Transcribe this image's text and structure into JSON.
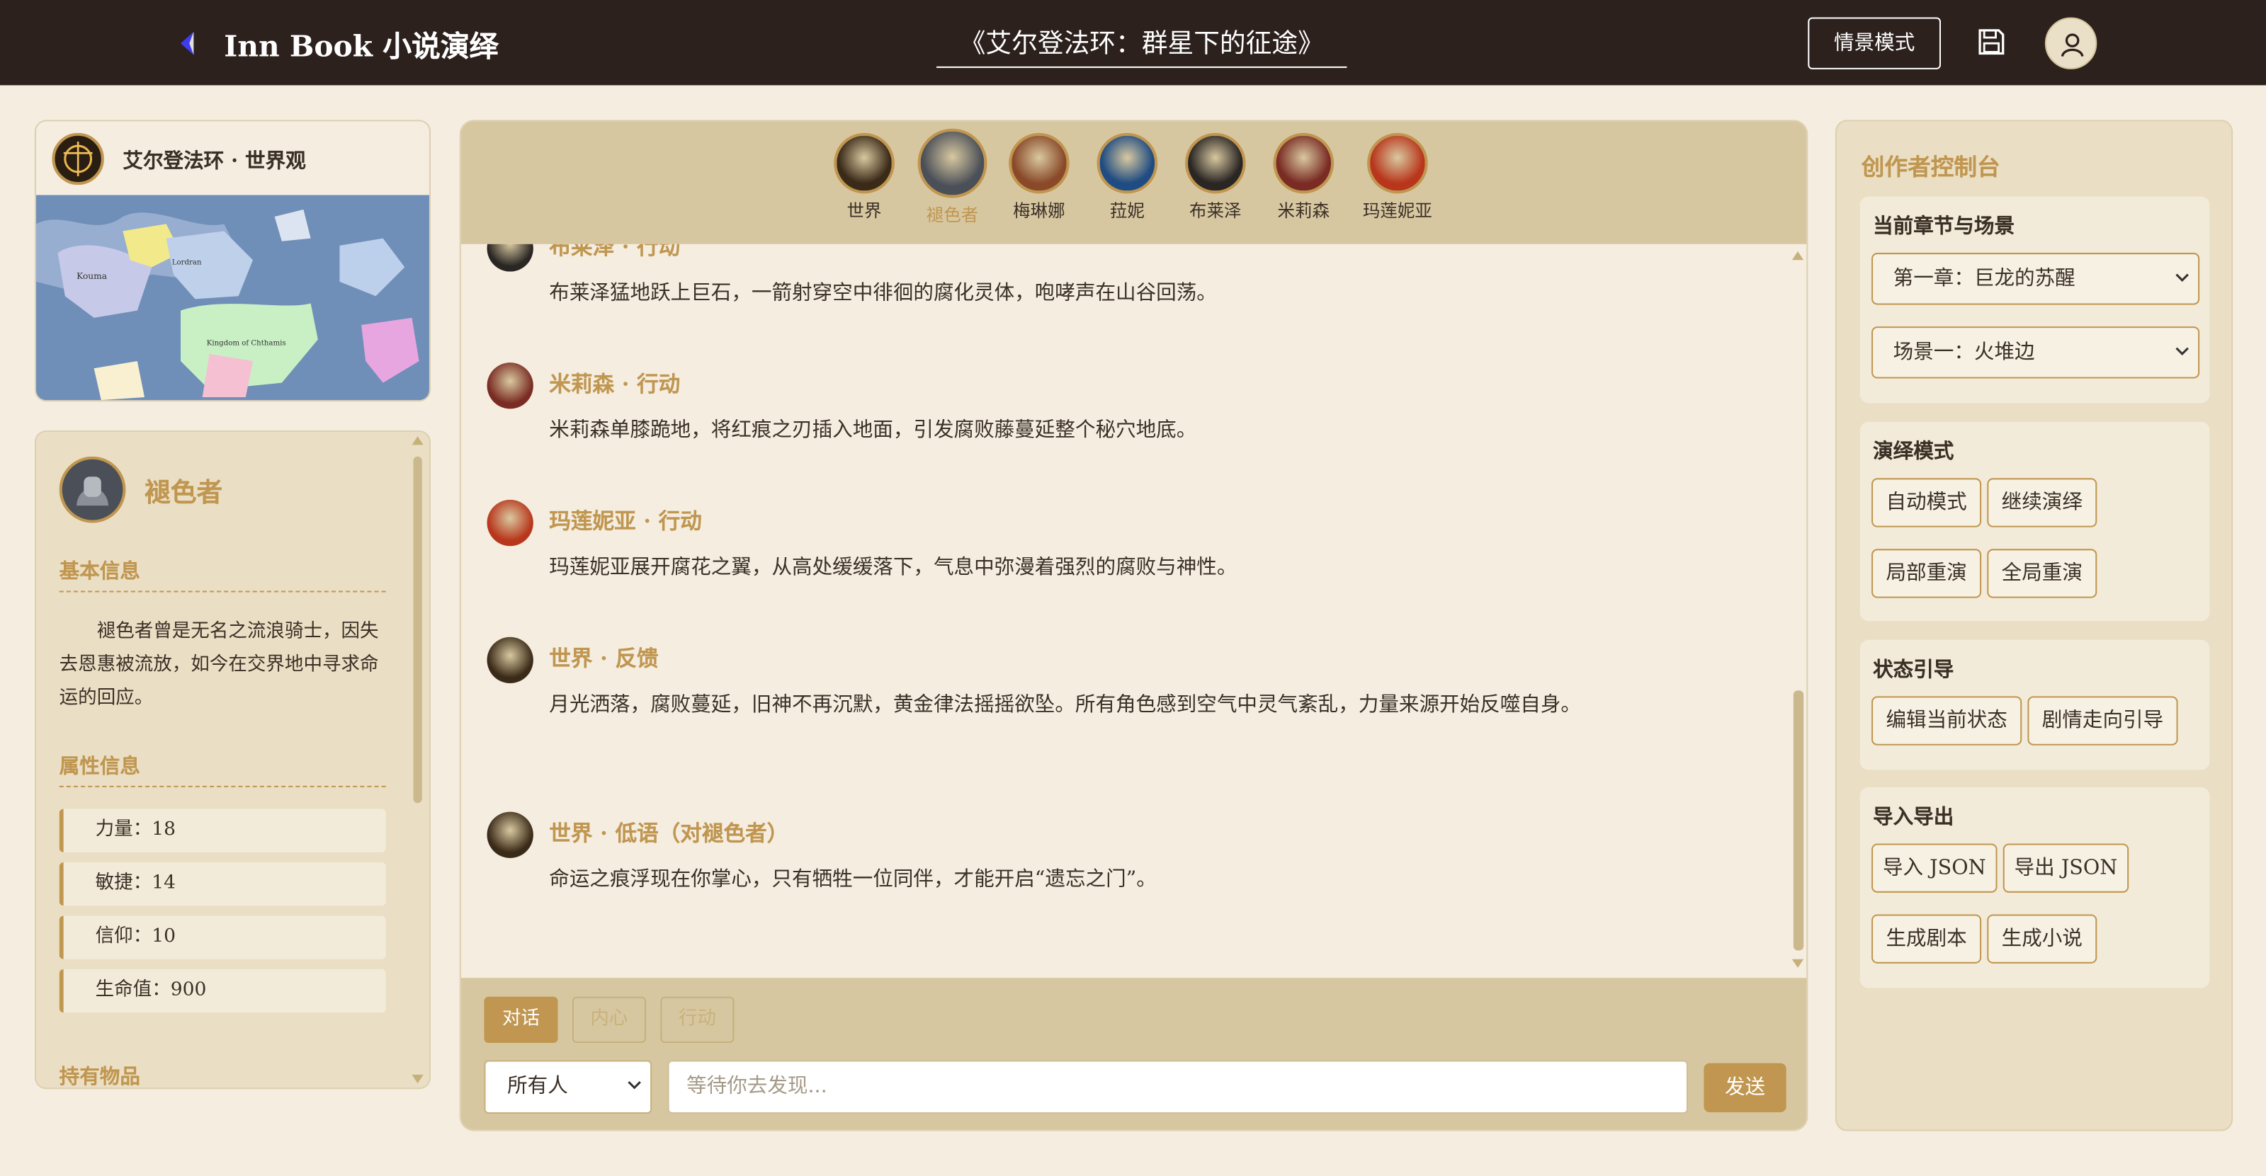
{
  "header": {
    "brand": "Inn Book 小说演绎",
    "book_title": "《艾尔登法环：群星下的征途》",
    "mode_button": "情景模式"
  },
  "world": {
    "title": "艾尔登法环 · 世界观",
    "map_labels": [
      "Kouma",
      "Lordran",
      "Kingdom of Chthamis"
    ]
  },
  "character": {
    "name": "褪色者",
    "basic_info_title": "基本信息",
    "bio": "褪色者曾是无名之流浪骑士，因失去恩惠被流放，如今在交界地中寻求命运的回应。",
    "attributes_title": "属性信息",
    "attributes": [
      "力量：18",
      "敏捷：14",
      "信仰：10",
      "生命值：900"
    ],
    "items_title": "持有物品"
  },
  "roster": [
    {
      "label": "世界",
      "color": "#3a2a18"
    },
    {
      "label": "褪色者",
      "color": "#4a4f58"
    },
    {
      "label": "梅琳娜",
      "color": "#8a4a2a"
    },
    {
      "label": "菈妮",
      "color": "#1f4c82"
    },
    {
      "label": "布莱泽",
      "color": "#2a2624"
    },
    {
      "label": "米莉森",
      "color": "#7a2c24"
    },
    {
      "label": "玛莲妮亚",
      "color": "#b8361c"
    }
  ],
  "messages": [
    {
      "header": "布莱泽 · 行动",
      "body": "布莱泽猛地跃上巨石，一箭射穿空中徘徊的腐化灵体，咆哮声在山谷回荡。",
      "color": "#2a2624"
    },
    {
      "header": "米莉森 · 行动",
      "body": "米莉森单膝跪地，将红痕之刃插入地面，引发腐败藤蔓延整个秘穴地底。",
      "color": "#7a2c24"
    },
    {
      "header": "玛莲妮亚 · 行动",
      "body": "玛莲妮亚展开腐花之翼，从高处缓缓落下，气息中弥漫着强烈的腐败与神性。",
      "color": "#b8361c"
    },
    {
      "header": "世界 · 反馈",
      "body": "月光洒落，腐败蔓延，旧神不再沉默，黄金律法摇摇欲坠。所有角色感到空气中灵气紊乱，力量来源开始反噬自身。",
      "color": "#3a2a18"
    },
    {
      "header": "世界 · 低语（对褪色者）",
      "body": "命运之痕浮现在你掌心，只有牺牲一位同伴，才能开启“遗忘之门”。",
      "color": "#3a2a18"
    }
  ],
  "composer": {
    "tabs": [
      "对话",
      "内心",
      "行动"
    ],
    "target": "所有人",
    "placeholder": "等待你去发现...",
    "send": "发送"
  },
  "control": {
    "title": "创作者控制台",
    "chapter_title": "当前章节与场景",
    "chapter": "第一章：巨龙的苏醒",
    "scene": "场景一：火堆边",
    "mode_title": "演绎模式",
    "mode_buttons": [
      "自动模式",
      "继续演绎",
      "局部重演",
      "全局重演"
    ],
    "state_title": "状态引导",
    "state_buttons": [
      "编辑当前状态",
      "剧情走向引导"
    ],
    "io_title": "导入导出",
    "io_buttons": [
      "导入 JSON",
      "导出 JSON",
      "生成剧本",
      "生成小说"
    ]
  },
  "colors": {
    "accent": "#c09650",
    "header_bg": "#2c211d",
    "panel_bg": "#eadfc4"
  }
}
